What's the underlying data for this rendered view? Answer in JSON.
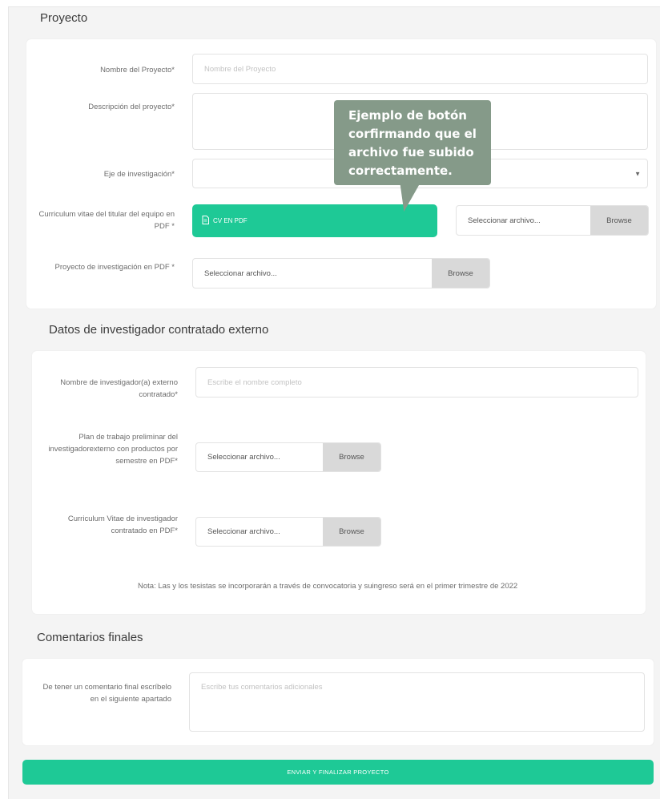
{
  "proyecto": {
    "title": "Proyecto",
    "nombre": {
      "label": "Nombre del Proyecto*",
      "placeholder": "Nombre del Proyecto"
    },
    "descripcion": {
      "label": "Descripción del proyecto*",
      "placeholder": ""
    },
    "eje": {
      "label": "Eje de investigación*",
      "value": ""
    },
    "cv_titular": {
      "label": "Curriculum vitae del titular del equipo en PDF *",
      "uploaded_label": "CV EN PDF",
      "file_text": "Seleccionar archivo...",
      "browse": "Browse"
    },
    "proyecto_pdf": {
      "label": "Proyecto de investigación en PDF *",
      "file_text": "Seleccionar archivo...",
      "browse": "Browse"
    }
  },
  "tooltip": {
    "text": "Ejemplo de botón corfirmando que el archivo fue subido correctamente."
  },
  "investigador": {
    "title": "Datos de investigador contratado externo",
    "nombre": {
      "label": "Nombre de investigador(a) externo contratado*",
      "placeholder": "Escribe el nombre completo"
    },
    "plan": {
      "label": "Plan de trabajo preliminar del investigadorexterno con productos por semestre en PDF*",
      "file_text": "Seleccionar archivo...",
      "browse": "Browse"
    },
    "cv": {
      "label": "Curriculum Vitae de investigador contratado en PDF*",
      "file_text": "Seleccionar archivo...",
      "browse": "Browse"
    },
    "note": "Nota: Las y los tesistas se incorporarán a través de convocatoria y suingreso será en el primer trimestre de 2022"
  },
  "comentarios": {
    "title": "Comentarios finales",
    "label": "De tener un comentario final escríbelo en el siguiente apartado",
    "placeholder": "Escribe tus comentarios adicionales"
  },
  "submit_label": "ENVIAR Y FINALIZAR PROYECTO",
  "colors": {
    "accent": "#1ec996",
    "tooltip": "#859a89",
    "browse_bg": "#d9d9d9"
  }
}
